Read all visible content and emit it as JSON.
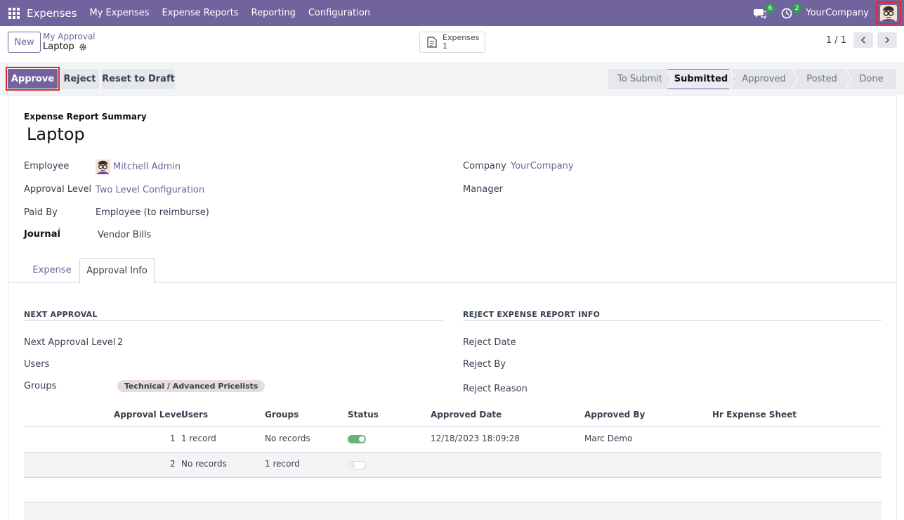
{
  "topbar": {
    "app_name": "Expenses",
    "menu": [
      "My Expenses",
      "Expense Reports",
      "Reporting",
      "Configuration"
    ],
    "messages_badge": "6",
    "activities_badge": "2",
    "company": "YourCompany",
    "accent_color": "#71639e"
  },
  "control_panel": {
    "new_label": "New",
    "breadcrumb_parent": "My Approval",
    "breadcrumb_current": "Laptop",
    "smart_button": {
      "label": "Expenses",
      "count": "1"
    },
    "pager_value": "1 / 1"
  },
  "statusbar": {
    "approve_label": "Approve",
    "reject_label": "Reject",
    "reset_label": "Reset to Draft",
    "stages": [
      "To Submit",
      "Submitted",
      "Approved",
      "Posted",
      "Done"
    ],
    "active_stage": "Submitted"
  },
  "form": {
    "summary_label": "Expense Report Summary",
    "title": "Laptop",
    "employee_label": "Employee",
    "employee_value": "Mitchell Admin",
    "approval_level_label": "Approval Level",
    "approval_level_value": "Two Level Configuration",
    "paid_by_label": "Paid By",
    "paid_by_value": "Employee (to reimburse)",
    "journal_label": "Journal",
    "journal_help": "?",
    "journal_value": "Vendor Bills",
    "company_label": "Company",
    "company_value": "YourCompany",
    "manager_label": "Manager"
  },
  "tabs": [
    {
      "label": "Expense",
      "active": false
    },
    {
      "label": "Approval Info",
      "active": true
    }
  ],
  "approval_info": {
    "next_approval_title": "NEXT APPROVAL",
    "next_level_label": "Next Approval Level",
    "next_level_value": "2",
    "users_label": "Users",
    "groups_label": "Groups",
    "group_tag": "Technical / Advanced Pricelists",
    "reject_title": "REJECT EXPENSE REPORT INFO",
    "reject_date_label": "Reject Date",
    "reject_by_label": "Reject By",
    "reject_reason_label": "Reject Reason"
  },
  "table": {
    "headers": [
      "Approval Level",
      "Users",
      "Groups",
      "Status",
      "Approved Date",
      "Approved By",
      "Hr Expense Sheet"
    ],
    "rows": [
      {
        "level": "1",
        "users": "1 record",
        "groups": "No records",
        "status": true,
        "date": "12/18/2023 18:09:28",
        "by": "Marc Demo",
        "sheet": ""
      },
      {
        "level": "2",
        "users": "No records",
        "groups": "1 record",
        "status": false,
        "date": "",
        "by": "",
        "sheet": ""
      }
    ]
  }
}
